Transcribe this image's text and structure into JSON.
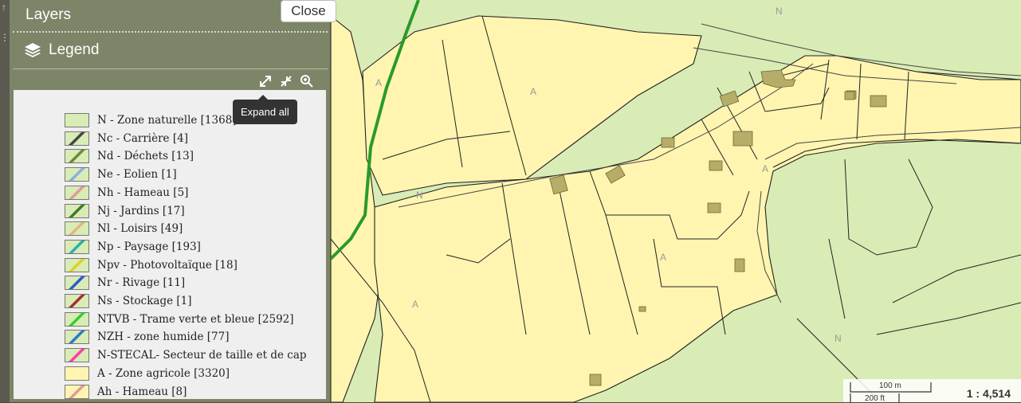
{
  "panel": {
    "title": "Layers",
    "close_label": "Close",
    "legend_title": "Legend",
    "tooltip": "Expand all"
  },
  "legend": [
    {
      "label": "N - Zone naturelle [1368]",
      "fill": "#d9ecb5",
      "hatch": ""
    },
    {
      "label": "Nc - Carrière [4]",
      "fill": "#d9ecb5",
      "hatch": "#444444"
    },
    {
      "label": "Nd - Déchets [13]",
      "fill": "#d9ecb5",
      "hatch": "#6a8a3a"
    },
    {
      "label": "Ne - Eolien [1]",
      "fill": "#d9ecb5",
      "hatch": "#8ab0e0"
    },
    {
      "label": "Nh - Hameau [5]",
      "fill": "#d9ecb5",
      "hatch": "#e09a9a"
    },
    {
      "label": "Nj - Jardins [17]",
      "fill": "#d9ecb5",
      "hatch": "#3a7a2a"
    },
    {
      "label": "Nl - Loisirs [49]",
      "fill": "#d9ecb5",
      "hatch": "#e0b87a"
    },
    {
      "label": "Np - Paysage [193]",
      "fill": "#d9ecb5",
      "hatch": "#2ab0b0"
    },
    {
      "label": "Npv - Photovoltaïque [18]",
      "fill": "#d9ecb5",
      "hatch": "#e0d020"
    },
    {
      "label": "Nr - Rivage [11]",
      "fill": "#d9ecb5",
      "hatch": "#2a5ad0"
    },
    {
      "label": "Ns - Stockage [1]",
      "fill": "#d9ecb5",
      "hatch": "#a03030"
    },
    {
      "label": "NTVB - Trame verte et bleue [2592]",
      "fill": "#d9ecb5",
      "hatch": "#30d030"
    },
    {
      "label": "NZH - zone humide [77]",
      "fill": "#d9ecb5",
      "hatch": "#2a7ad0"
    },
    {
      "label": "N-STECAL- Secteur de taille et de cap",
      "fill": "#d9ecb5",
      "hatch": "#ff3ab0"
    },
    {
      "label": "A - Zone agricole [3320]",
      "fill": "#fff5b0",
      "hatch": ""
    },
    {
      "label": "Ah - Hameau [8]",
      "fill": "#fff5b0",
      "hatch": "#e09a9a"
    }
  ],
  "map": {
    "zone_labels": [
      "N",
      "A",
      "A",
      "N",
      "A",
      "A",
      "A",
      "N"
    ],
    "colors": {
      "agri": "#fff5b0",
      "natural": "#d9ecb5",
      "building": "#b5ad68",
      "green_line": "#2a9a2a"
    }
  },
  "scale": {
    "metric": "100 m",
    "imperial": "200 ft",
    "ratio": "1 : 4,514"
  }
}
